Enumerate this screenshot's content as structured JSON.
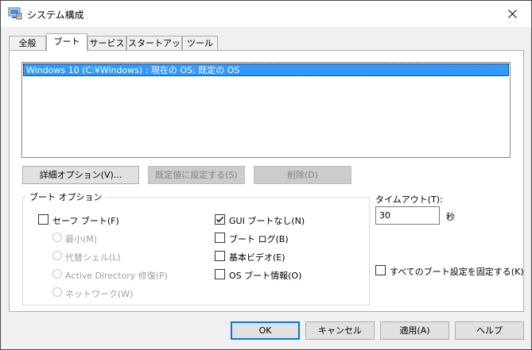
{
  "window": {
    "title": "システム構成",
    "close_glyph": "✕"
  },
  "tabs": [
    {
      "label": "全般"
    },
    {
      "label": "ブート"
    },
    {
      "label": "サービス"
    },
    {
      "label": "スタートアップ"
    },
    {
      "label": "ツール"
    }
  ],
  "os_list": {
    "items": [
      "Windows 10 (C:¥Windows) : 現在の OS; 既定の OS"
    ]
  },
  "boot_buttons": {
    "advanced": "詳細オプション(V)...",
    "set_default": "既定値に設定する(S)",
    "delete": "削除(D)"
  },
  "boot_options": {
    "label": "ブート オプション",
    "safe_boot": {
      "label": "セーフ ブート(F)",
      "checked": false
    },
    "radios": [
      "最小(M)",
      "代替シェル(L)",
      "Active Directory 修復(P)",
      "ネットワーク(W)"
    ],
    "no_gui_boot": {
      "label": "GUI ブートなし(N)",
      "checked": true
    },
    "boot_log": {
      "label": "ブート ログ(B)",
      "checked": false
    },
    "base_video": {
      "label": "基本ビデオ(E)",
      "checked": false
    },
    "os_boot_info": {
      "label": "OS ブート情報(O)",
      "checked": false
    }
  },
  "timeout": {
    "label": "タイムアウト(T):",
    "value": "30",
    "unit": "秒"
  },
  "make_permanent": {
    "label": "すべてのブート設定を固定する(K)",
    "checked": false
  },
  "dialog_buttons": {
    "ok": "OK",
    "cancel": "キャンセル",
    "apply": "適用(A)",
    "help": "ヘルプ"
  },
  "colors": {
    "selection": "#3399ff",
    "accent": "#0078d7"
  }
}
